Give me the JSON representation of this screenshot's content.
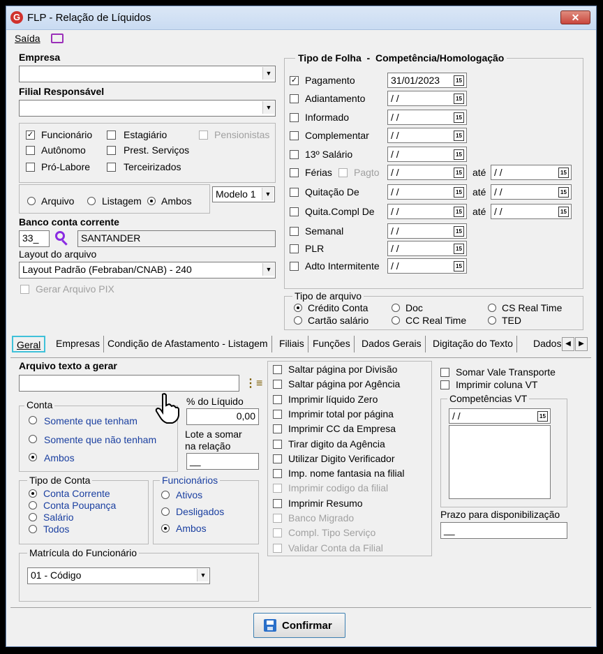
{
  "window": {
    "title": "FLP - Relação de Líquidos",
    "close_glyph": "✕"
  },
  "menu": {
    "saida": "Saída"
  },
  "empresa": {
    "label": "Empresa",
    "value": ""
  },
  "filial": {
    "label": "Filial Responsável",
    "value": ""
  },
  "tipos_func": {
    "funcionario": "Funcionário",
    "estagiario": "Estagiário",
    "pensionistas": "Pensionistas",
    "autonomo": "Autônomo",
    "prest_servicos": "Prest. Serviços",
    "pro_labore": "Pró-Labore",
    "terceirizados": "Terceirizados"
  },
  "saida_tipo": {
    "arquivo": "Arquivo",
    "listagem": "Listagem",
    "ambos": "Ambos",
    "selected": "Ambos",
    "modelo": "Modelo 1"
  },
  "banco": {
    "label": "Banco conta corrente",
    "code": "33_",
    "name": "SANTANDER"
  },
  "layout": {
    "label": "Layout do arquivo",
    "value": "Layout Padrão (Febraban/CNAB) - 240"
  },
  "pix": {
    "label": "Gerar Arquivo PIX"
  },
  "folha": {
    "title_tipo": "Tipo de Folha",
    "dash": "-",
    "title_comp": "Competência/Homologação",
    "ate": "até",
    "calendar_glyph": "15",
    "rows": [
      {
        "label": "Pagamento",
        "checked": true,
        "date": "31/01/2023"
      },
      {
        "label": "Adiantamento",
        "checked": false,
        "date": "/ /"
      },
      {
        "label": "Informado",
        "checked": false,
        "date": "/ /"
      },
      {
        "label": "Complementar",
        "checked": false,
        "date": "/ /"
      },
      {
        "label": "13º Salário",
        "checked": false,
        "date": "/ /"
      },
      {
        "label": "Férias",
        "checked": false,
        "date": "/ /",
        "extra": "Pagto",
        "date2": "/ /"
      },
      {
        "label": "Quitação De",
        "checked": false,
        "date": "/ /",
        "date2": "/ /"
      },
      {
        "label": "Quita.Compl De",
        "checked": false,
        "date": "/ /",
        "date2": "/ /"
      },
      {
        "label": "Semanal",
        "checked": false,
        "date": "/ /"
      },
      {
        "label": "PLR",
        "checked": false,
        "date": "/ /"
      },
      {
        "label": "Adto Intermitente",
        "checked": false,
        "date": "/ /"
      }
    ]
  },
  "tipo_arquivo": {
    "title": "Tipo de arquivo",
    "credito": "Crédito Conta",
    "doc": "Doc",
    "cs": "CS Real Time",
    "cartao": "Cartão salário",
    "cc": "CC Real Time",
    "ted": "TED"
  },
  "tabs": [
    "Geral",
    "Empresas",
    "Condição de Afastamento - Listagem",
    "Filiais",
    "Funções",
    "Dados Gerais",
    "Digitação do Texto",
    "Dados"
  ],
  "geral": {
    "arquivo_label": "Arquivo texto a gerar",
    "arquivo_value": "",
    "conta_title": "Conta",
    "conta_1": "Somente que tenham",
    "conta_2": "Somente que não tenham",
    "conta_3": "Ambos",
    "pct_label": "% do Líquido",
    "pct_value": "0,00",
    "lote_label1": "Lote a somar",
    "lote_label2": "na relação",
    "lote_value": "__",
    "tipo_conta_title": "Tipo de Conta",
    "tc_1": "Conta Corrente",
    "tc_2": "Conta Poupança",
    "tc_3": "Salário",
    "tc_4": "Todos",
    "func_title": "Funcionários",
    "f_1": "Ativos",
    "f_2": "Desligados",
    "f_3": "Ambos",
    "matricula_title": "Matrícula do Funcionário",
    "matricula_value": "01 - Código"
  },
  "options": [
    {
      "label": "Saltar página por Divisão",
      "enabled": true
    },
    {
      "label": "Saltar página por Agência",
      "enabled": true
    },
    {
      "label": "Imprimir líquido Zero",
      "enabled": true
    },
    {
      "label": "Imprimir total por página",
      "enabled": true
    },
    {
      "label": "Imprimir CC da Empresa",
      "enabled": true
    },
    {
      "label": "Tirar digito da Agência",
      "enabled": true
    },
    {
      "label": "Utilizar Digito Verificador",
      "enabled": true
    },
    {
      "label": "Imp. nome fantasia na filial",
      "enabled": true
    },
    {
      "label": "Imprimir codigo da filial",
      "enabled": false
    },
    {
      "label": "Imprimir Resumo",
      "enabled": true
    },
    {
      "label": "Banco Migrado",
      "enabled": false
    },
    {
      "label": "Compl. Tipo Serviço",
      "enabled": false
    },
    {
      "label": "Validar Conta da Filial",
      "enabled": false
    }
  ],
  "vt": {
    "somar": "Somar Vale Transporte",
    "imprimir": "Imprimir coluna VT",
    "comp_title": "Competências VT",
    "comp_value": "/ /",
    "prazo_label": "Prazo para disponibilização",
    "prazo_value": "__"
  },
  "confirm": {
    "label": "Confirmar"
  },
  "colors": {
    "title_bg": "#c9dbf2",
    "close_red": "#c9463d",
    "tab_highlight": "#3fc1d9",
    "confirm_blue": "#2a6fc9"
  }
}
